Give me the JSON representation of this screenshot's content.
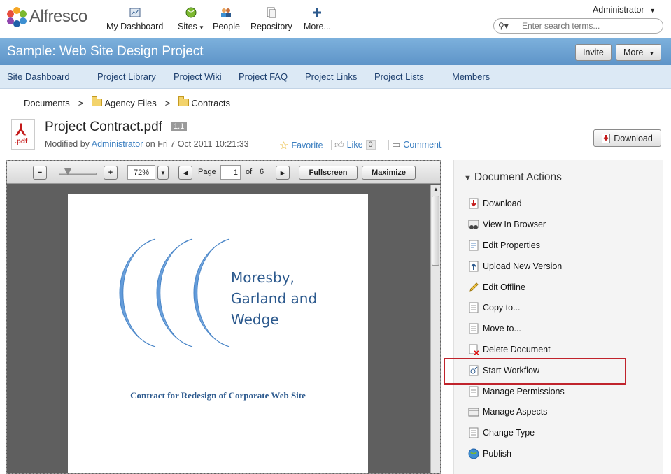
{
  "header": {
    "logo_text": "Alfresco",
    "nav": [
      {
        "label": "My Dashboard",
        "icon": "dashboard-icon"
      },
      {
        "label": "Sites",
        "icon": "globe-icon"
      },
      {
        "label": "People",
        "icon": "people-icon"
      },
      {
        "label": "Repository",
        "icon": "repository-icon"
      },
      {
        "label": "More...",
        "icon": "plus-icon"
      }
    ],
    "user": "Administrator",
    "search_placeholder": "Enter search terms..."
  },
  "site": {
    "title": "Sample: Web Site Design Project",
    "invite_label": "Invite",
    "more_label": "More"
  },
  "site_nav": [
    "Site Dashboard",
    "Project Library",
    "Project Wiki",
    "Project FAQ",
    "Project Links",
    "Project Lists",
    "Members"
  ],
  "breadcrumb": {
    "root": "Documents",
    "sep": ">",
    "items": [
      "Agency Files",
      "Contracts"
    ]
  },
  "document": {
    "title": "Project Contract.pdf",
    "version": "1.1",
    "icon_ext": ".pdf",
    "modified_prefix": "Modified by",
    "modified_by": "Administrator",
    "modified_on": "on Fri 7 Oct 2011 10:21:33",
    "favorite_label": "Favorite",
    "like_label": "Like",
    "like_count": "0",
    "comment_label": "Comment",
    "download_label": "Download"
  },
  "viewer": {
    "zoom": "72%",
    "page_label": "Page",
    "page": "1",
    "of_label": "of",
    "total_pages": "6",
    "fullscreen_label": "Fullscreen",
    "maximize_label": "Maximize",
    "pdf_heading_lines": [
      "Moresby,",
      "Garland and",
      "Wedge"
    ],
    "pdf_caption": "Contract for Redesign of Corporate Web Site"
  },
  "actions": {
    "title": "Document Actions",
    "items": [
      {
        "label": "Download",
        "icon": "download-icon"
      },
      {
        "label": "View In Browser",
        "icon": "view-browser-icon"
      },
      {
        "label": "Edit Properties",
        "icon": "edit-properties-icon"
      },
      {
        "label": "Upload New Version",
        "icon": "upload-icon"
      },
      {
        "label": "Edit Offline",
        "icon": "pencil-icon"
      },
      {
        "label": "Copy to...",
        "icon": "copy-icon"
      },
      {
        "label": "Move to...",
        "icon": "move-icon"
      },
      {
        "label": "Delete Document",
        "icon": "delete-icon"
      },
      {
        "label": "Start Workflow",
        "icon": "workflow-icon"
      },
      {
        "label": "Manage Permissions",
        "icon": "permissions-icon"
      },
      {
        "label": "Manage Aspects",
        "icon": "aspects-icon"
      },
      {
        "label": "Change Type",
        "icon": "change-type-icon"
      },
      {
        "label": "Publish",
        "icon": "publish-icon"
      }
    ],
    "highlighted": "Start Workflow"
  },
  "colors": {
    "site_bar": "#6fa3d2",
    "nav_bg": "#dce9f5",
    "link": "#3a7ec0",
    "highlight": "#c0232c"
  }
}
